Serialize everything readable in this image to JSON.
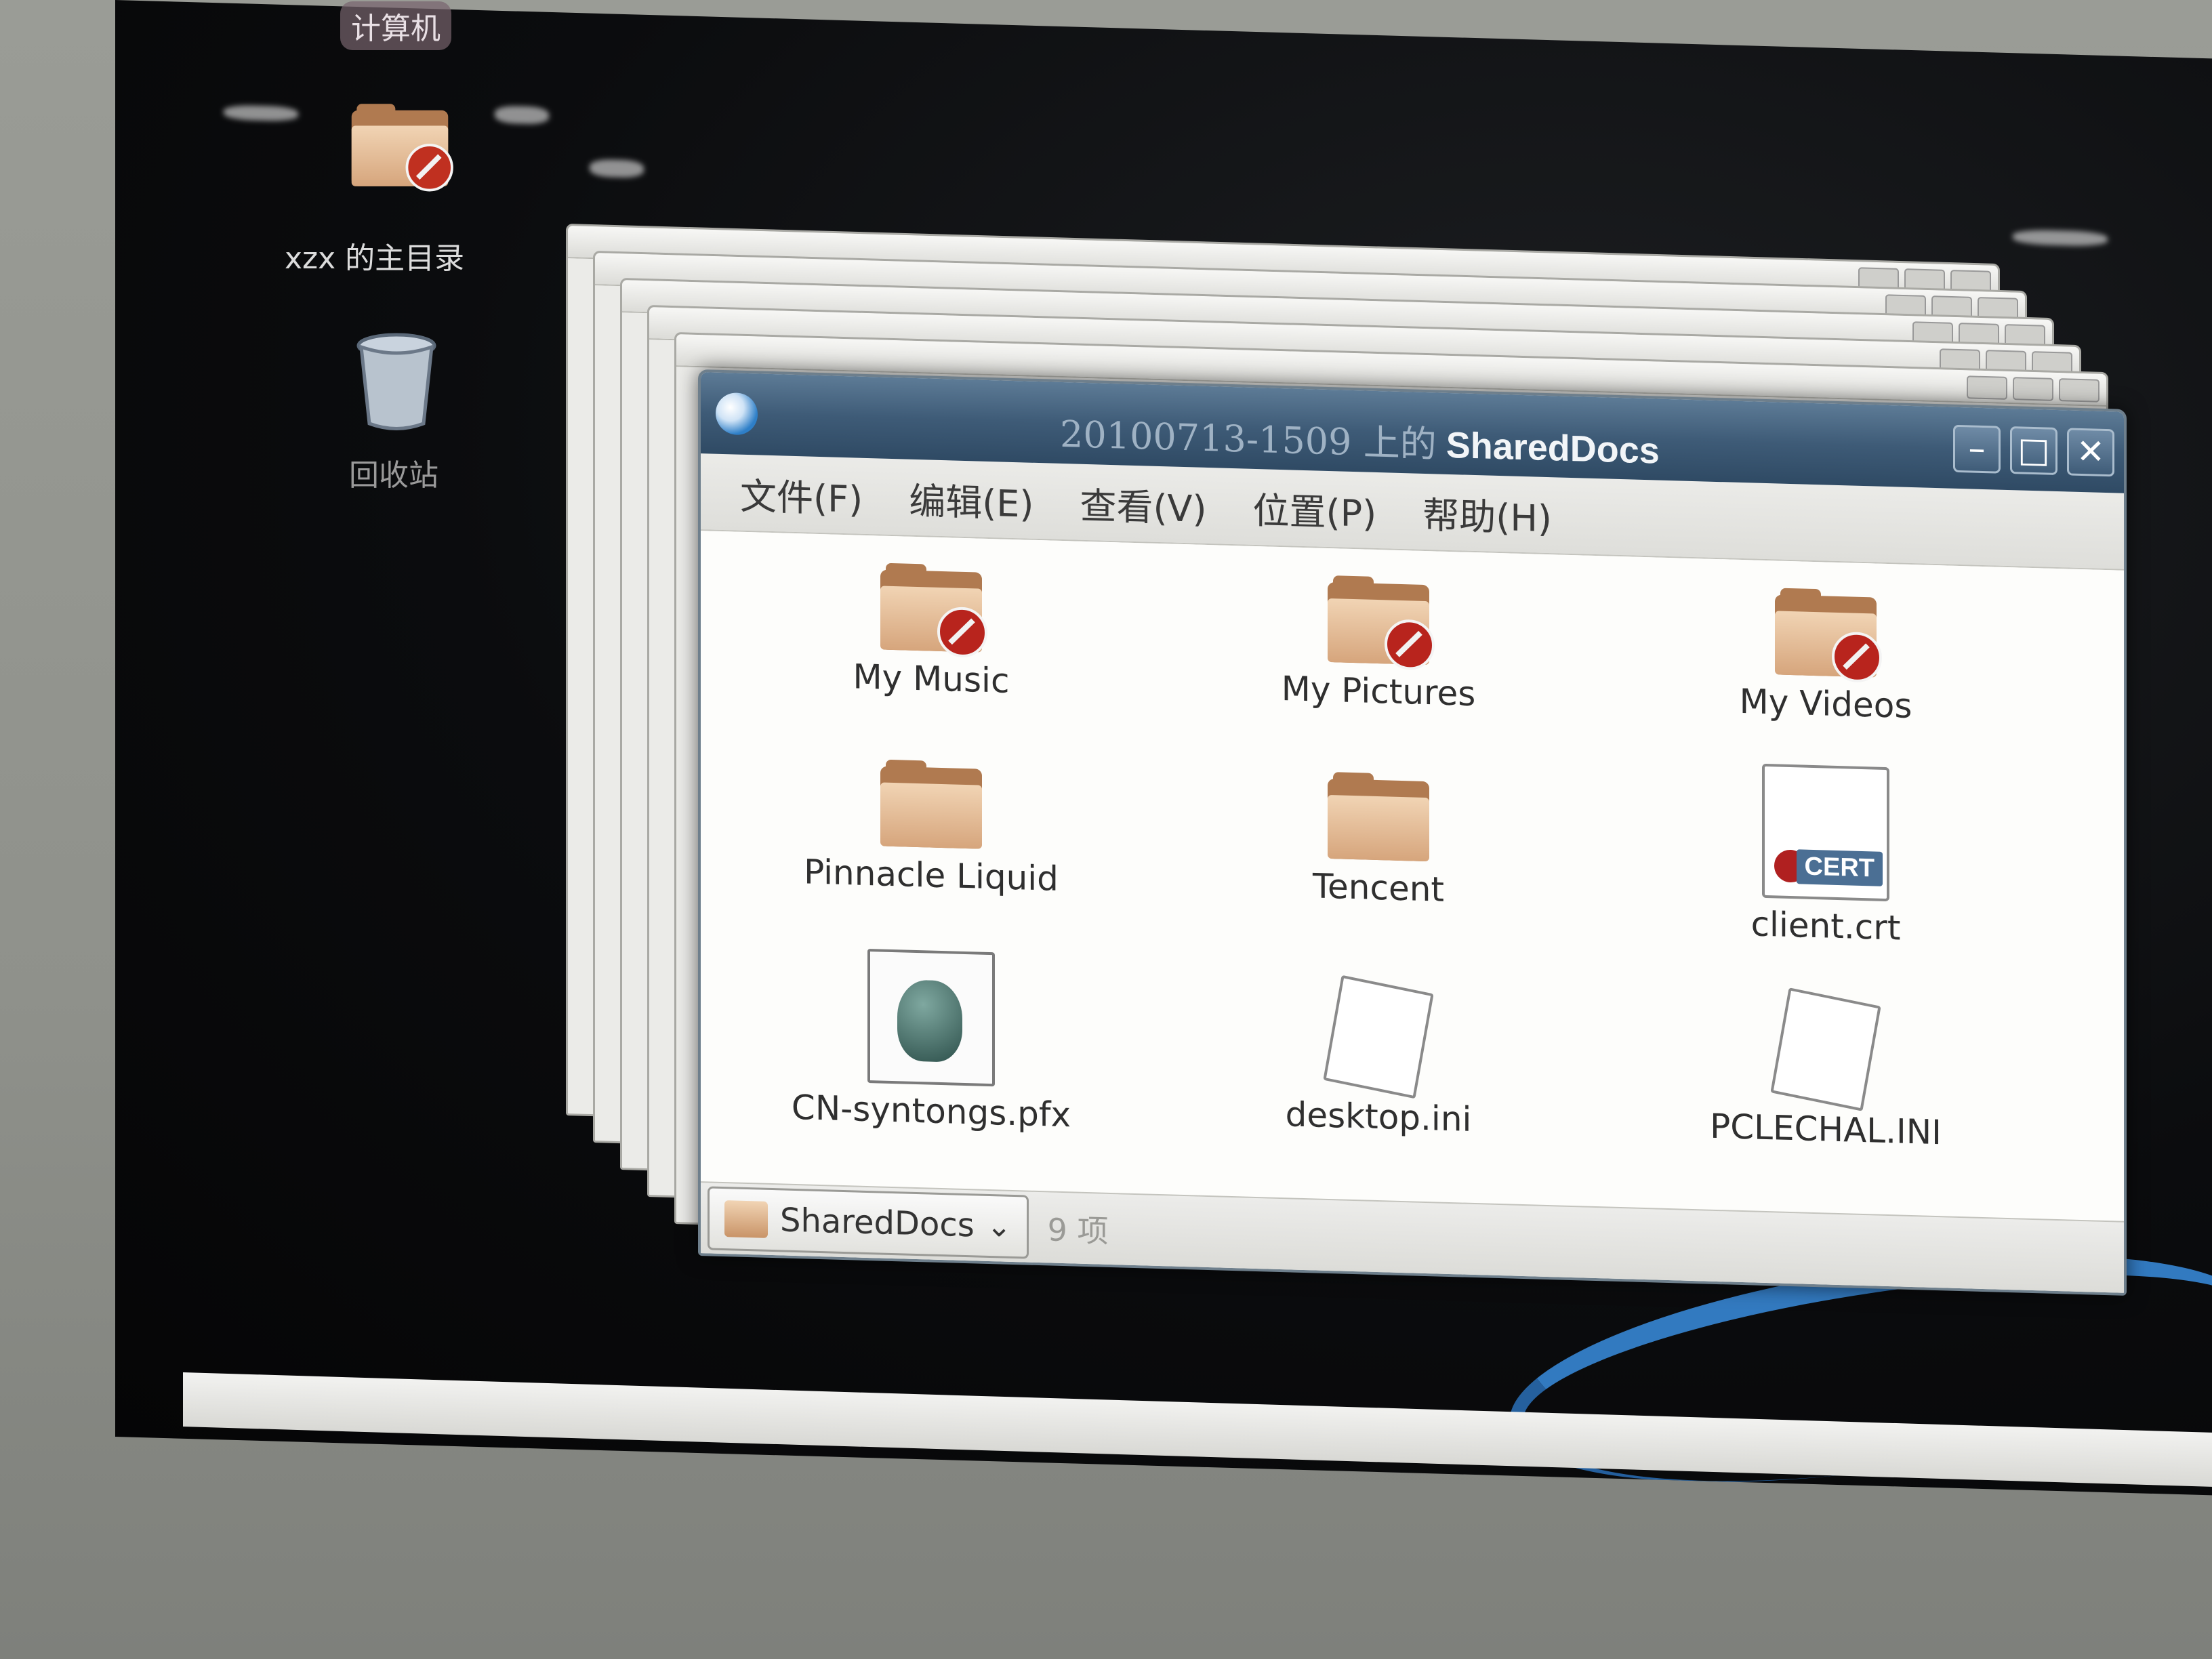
{
  "desktop": {
    "top_label": "计算机",
    "home_folder_label": "xzx 的主目录",
    "trash_label": "回收站"
  },
  "window": {
    "title_prefix": "20100713-1509 上的",
    "title_name": "SharedDocs",
    "buttons": {
      "minimize": "–",
      "maximize": "□",
      "close": "✕"
    },
    "menu": [
      "文件(F)",
      "编辑(E)",
      "查看(V)",
      "位置(P)",
      "帮助(H)"
    ],
    "items": [
      {
        "label": "My Music",
        "icon": "shared-folder-icon"
      },
      {
        "label": "My Pictures",
        "icon": "shared-folder-icon"
      },
      {
        "label": "My Videos",
        "icon": "shared-folder-icon"
      },
      {
        "label": "Pinnacle Liquid",
        "icon": "folder-icon"
      },
      {
        "label": "Tencent",
        "icon": "folder-icon"
      },
      {
        "label": "client.crt",
        "icon": "certificate-icon"
      },
      {
        "label": "CN-syntongs.pfx",
        "icon": "gimp-file-icon"
      },
      {
        "label": "desktop.ini",
        "icon": "blank-file-icon"
      },
      {
        "label": "PCLECHAL.INI",
        "icon": "blank-file-icon"
      }
    ],
    "status": {
      "location": "SharedDocs",
      "count": "9 项"
    }
  },
  "colors": {
    "titlebar": "#3e5b77",
    "folder": "#d6a57c",
    "desktop": "#0b0c0e"
  }
}
